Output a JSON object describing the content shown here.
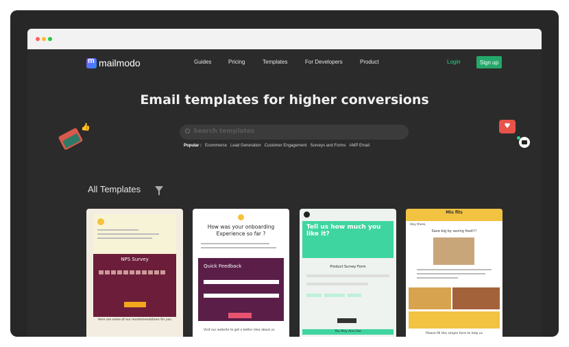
{
  "nav": {
    "brand": "mailmodo",
    "links": [
      "Guides",
      "Pricing",
      "Templates",
      "For Developers",
      "Product"
    ],
    "login": "Login",
    "signup": "Sign up"
  },
  "hero": {
    "title": "Email templates for higher conversions",
    "search_placeholder": "Search templates",
    "popular_label": "Popular :",
    "popular_tags": [
      "Ecommerce",
      "Lead Generation",
      "Customer Engagement",
      "Surveys and Forms",
      "AMP Email"
    ]
  },
  "section": {
    "title": "All Templates"
  },
  "cards": [
    {
      "heading": "NPS Survey",
      "footer": "Here are some of our recommendations for you"
    },
    {
      "heading": "How was your onboarding Experience so far ?",
      "form_title": "Quick Feedback",
      "footer": "Visit our website to get a better idea about us"
    },
    {
      "heading": "Tell us how much you like it?",
      "form_title": "Product Survey Form",
      "footer": "You May Also like"
    },
    {
      "brand": "Mis fits",
      "greeting": "Hey there,",
      "heading": "Save big by saving food!!!",
      "footer": "Please fill this simple form to help us"
    }
  ]
}
